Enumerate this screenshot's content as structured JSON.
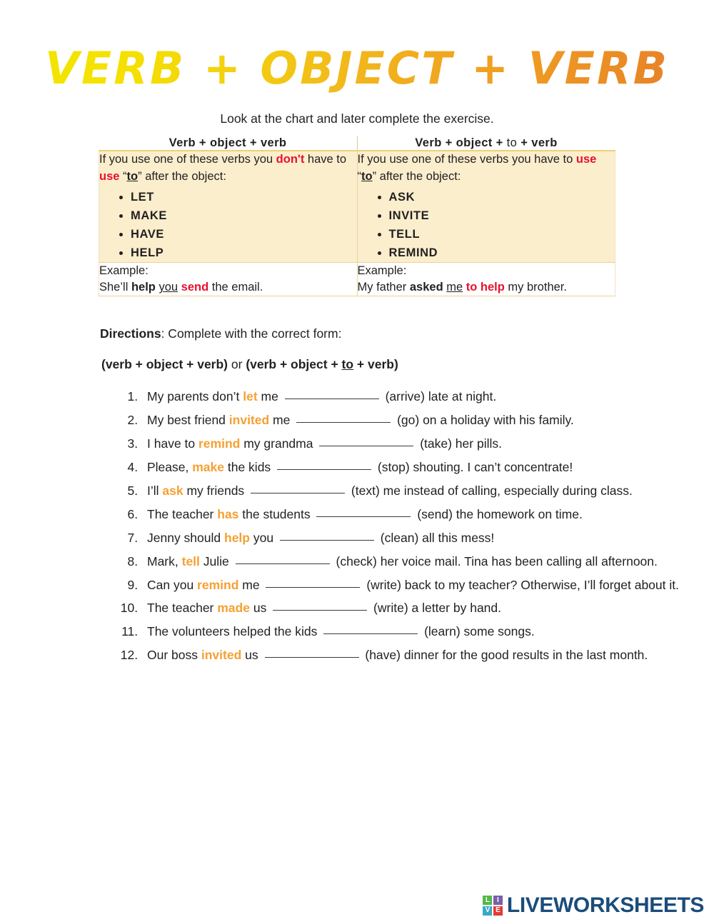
{
  "title": "VERB + OBJECT + VERB",
  "intro": "Look at the chart and later complete the exercise.",
  "chart": {
    "headers": {
      "left": "Verb + object + verb",
      "right_before": "Verb + object + ",
      "right_to": "to",
      "right_after": " + verb"
    },
    "left": {
      "rule_part1": "If you use one of these verbs you ",
      "rule_dont": "don't",
      "rule_part2": " have to ",
      "rule_use": "use",
      "rule_quote_open": " “",
      "rule_to": "to",
      "rule_quote_close": "”",
      "rule_part3": " after the object:",
      "verbs": [
        "LET",
        "MAKE",
        "HAVE",
        "HELP"
      ],
      "example_label": "Example:",
      "example": {
        "p1": "She’ll ",
        "bold1": "help",
        "p2": " ",
        "under1": "you",
        "p3": " ",
        "red1": "send",
        "p4": " the email."
      }
    },
    "right": {
      "rule_part1": "If you use one of these verbs you have to ",
      "rule_use": "use",
      "rule_quote_open": " “",
      "rule_to": "to",
      "rule_quote_close": "”",
      "rule_part3": " after the object:",
      "verbs": [
        "ASK",
        "INVITE",
        "TELL",
        "REMIND"
      ],
      "example_label": "Example:",
      "example": {
        "p1": "My father ",
        "bold1": "asked",
        "p2": " ",
        "under1": "me",
        "p3": " ",
        "red1": "to help",
        "p4": " my brother."
      }
    }
  },
  "directions": {
    "label": "Directions",
    "text": ": Complete with the correct form:"
  },
  "forms": {
    "a": "(verb + object + verb)",
    "or": " or ",
    "b_pre": "(verb + object + ",
    "b_to": "to",
    "b_post": " + verb)"
  },
  "exercises": [
    {
      "pre": "My parents don’t ",
      "verb": "let",
      "mid": " me ",
      "after": " (arrive) late at night."
    },
    {
      "pre": "My best friend ",
      "verb": "invited",
      "mid": " me ",
      "after": " (go) on a holiday with his family."
    },
    {
      "pre": "I have to ",
      "verb": "remind",
      "mid": " my grandma ",
      "after": " (take) her pills."
    },
    {
      "pre": "Please, ",
      "verb": "make",
      "mid": " the kids ",
      "after": " (stop) shouting. I can’t concentrate!"
    },
    {
      "pre": "I’ll ",
      "verb": "ask",
      "mid": " my friends ",
      "after": " (text) me instead of calling, especially during class."
    },
    {
      "pre": "The teacher ",
      "verb": "has",
      "mid": " the students ",
      "after": " (send) the homework on time."
    },
    {
      "pre": "Jenny should ",
      "verb": "help",
      "mid": " you ",
      "after": " (clean) all this mess!"
    },
    {
      "pre": "Mark, ",
      "verb": "tell",
      "mid": " Julie ",
      "after": " (check) her voice mail. Tina has been calling all afternoon."
    },
    {
      "pre": "Can you ",
      "verb": "remind",
      "mid": " me ",
      "after": " (write) back to my teacher? Otherwise, I’ll forget about it."
    },
    {
      "pre": "The teacher ",
      "verb": "made",
      "mid": " us ",
      "after": " (write) a letter by hand."
    },
    {
      "pre": "The volunteers helped the kids ",
      "verb": "",
      "mid": "",
      "after": " (learn) some songs."
    },
    {
      "pre": "Our boss ",
      "verb": "invited",
      "mid": " us ",
      "after": " (have) dinner for the good results in the last month."
    }
  ],
  "footer": {
    "logo_letters": [
      "L",
      "I",
      "V",
      "E"
    ],
    "logo_text": "LIVEWORKSHEETS"
  },
  "colors": {
    "accent_orange": "#f5a033",
    "accent_red": "#e8112d",
    "chart_bg": "#fbeecd",
    "logo_blue": "#1b4c7a"
  }
}
